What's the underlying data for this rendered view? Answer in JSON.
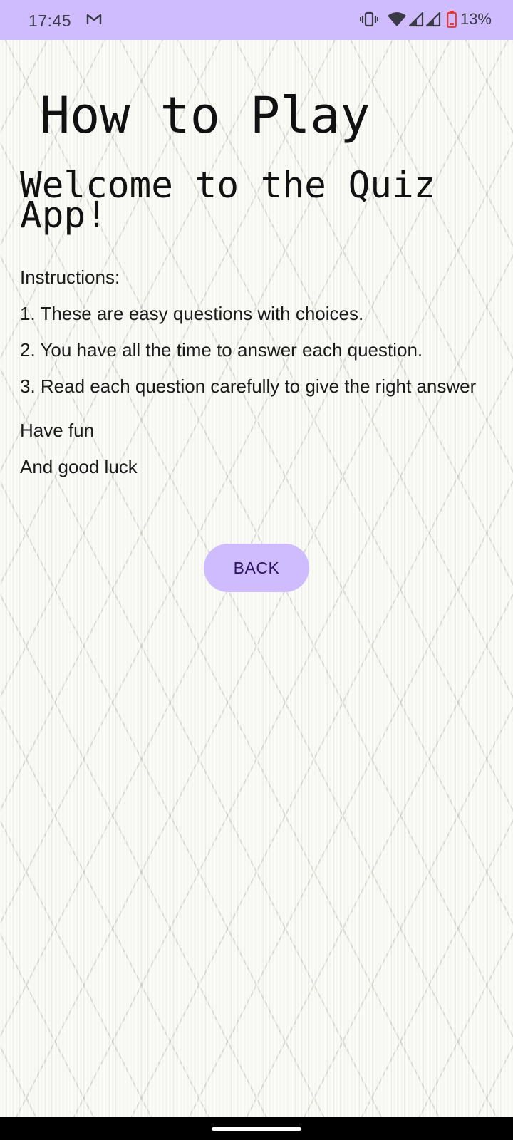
{
  "status_bar": {
    "time": "17:45",
    "notification_icon": "gmail-icon",
    "icons": [
      "vibrate-icon",
      "wifi-icon",
      "signal-icon",
      "signal-icon",
      "battery-low-icon"
    ],
    "battery_percent": "13%",
    "background_color": "#cfbcff",
    "battery_color": "#e53935"
  },
  "page": {
    "title": "How to Play",
    "heading": "Welcome to the Quiz App!",
    "instructions_label": "Instructions:",
    "instructions": [
      "1. These are easy questions with choices.",
      "2. You have all the time to answer each question.",
      "3. Read each question carefully to give the right answer"
    ],
    "closing_1": "Have fun",
    "closing_2": "And good luck"
  },
  "back_button": {
    "label": "BACK",
    "background_color": "#cfbcff",
    "text_color": "#2b1466"
  },
  "nav_bar": {
    "indicator": "home-indicator"
  }
}
